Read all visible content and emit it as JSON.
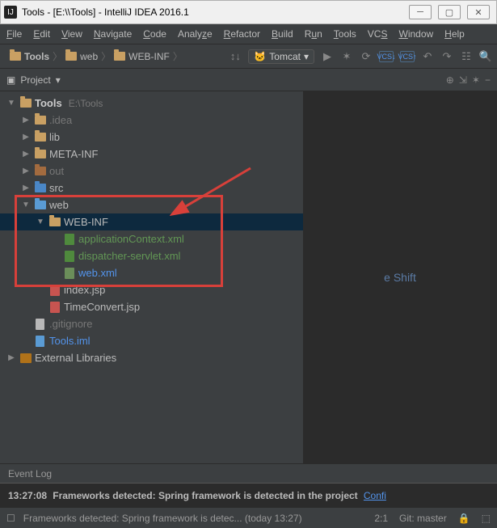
{
  "window": {
    "title": "Tools - [E:\\\\Tools] - IntelliJ IDEA 2016.1",
    "min": "─",
    "max": "▢",
    "close": "✕"
  },
  "menu": {
    "file": "File",
    "edit": "Edit",
    "view": "View",
    "navigate": "Navigate",
    "code": "Code",
    "analyze": "Analyze",
    "refactor": "Refactor",
    "build": "Build",
    "run": "Run",
    "tools": "Tools",
    "vcs": "VCS",
    "window": "Window",
    "help": "Help"
  },
  "breadcrumb": {
    "root": "Tools",
    "p1": "web",
    "p2": "WEB-INF"
  },
  "runconfig": {
    "label": "Tomcat",
    "dropdown": "▾"
  },
  "toolbar_icons": {
    "align": "↕↓",
    "run": "▶",
    "debug": "✶",
    "attach": "⟳",
    "vcs1": "VCS↓",
    "vcs2": "VCS↑",
    "back": "↶",
    "fwd": "↷",
    "struct": "☷",
    "search": "🔍"
  },
  "project_panel": {
    "tab_icon": "▣",
    "title": "Project",
    "dropdown": "▾",
    "r_icons": {
      "target": "⊕",
      "collapse": "⇲",
      "gear": "✶",
      "hide": "−"
    }
  },
  "tree": {
    "root": {
      "name": "Tools",
      "path": "E:\\Tools"
    },
    "idea": ".idea",
    "lib": "lib",
    "metainf": "META-INF",
    "out": "out",
    "src": "src",
    "web": "web",
    "webinf": "WEB-INF",
    "appctx": "applicationContext.xml",
    "dispatch": "dispatcher-servlet.xml",
    "webxml": "web.xml",
    "indexjsp": "index.jsp",
    "timeconv": "TimeConvert.jsp",
    "gitignore": ".gitignore",
    "toolsiml": "Tools.iml",
    "extlib": "External Libraries"
  },
  "editor": {
    "hint_suffix": "e Shift"
  },
  "eventlog": {
    "label": "Event Log"
  },
  "console": {
    "time": "13:27:08",
    "msg": "Frameworks detected: Spring framework is detected in the project",
    "link": "Confi"
  },
  "status": {
    "icon": "☐",
    "msg": "Frameworks detected: Spring framework is detec...  (today 13:27)",
    "pos": "2:1",
    "git": "Git: master",
    "lock": "🔒",
    "ind": "⬚"
  }
}
